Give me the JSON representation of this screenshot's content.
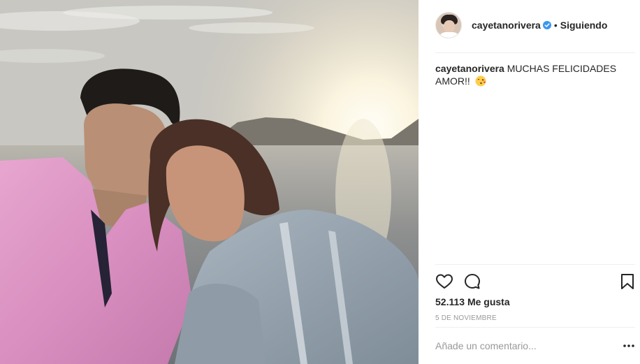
{
  "post": {
    "username": "cayetanorivera",
    "verified": true,
    "follow_status": "Siguiendo",
    "separator_dot": "•",
    "caption_user": "cayetanorivera",
    "caption_text": "MUCHAS FELICIDADES AMOR!!",
    "caption_emoji": "kissing-face-emoji",
    "likes_text": "52.113 Me gusta",
    "date_text": "5 DE NOVIEMBRE",
    "comment_placeholder": "Añade un comentario...",
    "icons": [
      "heart-icon",
      "comment-icon",
      "bookmark-icon",
      "more-options-icon",
      "verified-badge-icon"
    ],
    "colors": {
      "verified_blue": "#3897f0",
      "text": "#262626",
      "muted": "#999999",
      "divider": "#efefef"
    }
  }
}
